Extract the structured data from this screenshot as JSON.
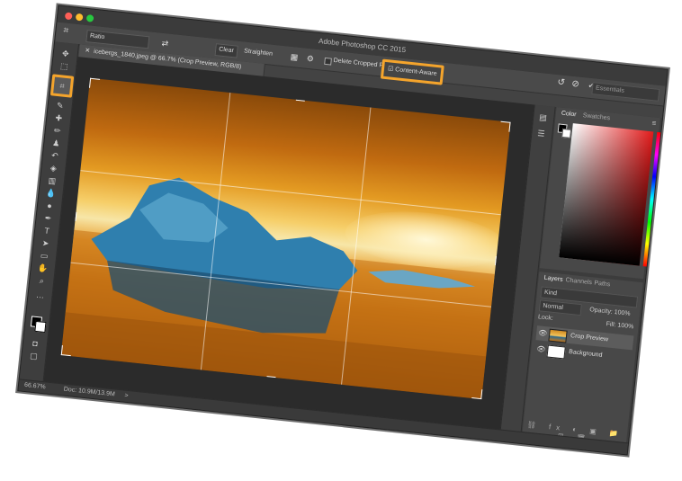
{
  "window": {
    "title": "Adobe Photoshop CC 2015"
  },
  "options_bar": {
    "tool_icon": "crop-options-icon",
    "ratio": "Ratio",
    "swap_icon": "⇄",
    "clear": "Clear",
    "straighten": "Straighten",
    "delete_cropped": "Delete Cropped Pixels",
    "content_aware": "Content-Aware",
    "search_placeholder": "Essentials"
  },
  "document": {
    "tab_label": "icebergs_1840.jpeg @ 66.7% (Crop Preview, RGB/8)",
    "zoom": "66.67%",
    "doc_info": "Doc: 10.9M/13.9M",
    "status_arrow": ">"
  },
  "toolbar": {
    "tools": [
      "move-icon",
      "marquee-icon",
      "lasso-icon",
      "quick-select-icon",
      "crop-icon",
      "eyedropper-icon",
      "healing-icon",
      "brush-icon",
      "stamp-icon",
      "history-brush-icon",
      "eraser-icon",
      "gradient-icon",
      "blur-icon",
      "dodge-icon",
      "pen-icon",
      "type-icon",
      "path-select-icon",
      "shape-icon",
      "hand-icon",
      "zoom-icon",
      "more-tools-icon"
    ]
  },
  "color_panel": {
    "tabs": [
      "Color",
      "Swatches"
    ],
    "active_tab": "Color",
    "foreground": "#000000",
    "background": "#ffffff",
    "hue": "#e21b1b"
  },
  "layers_panel": {
    "tabs": [
      "Layers",
      "Channels",
      "Paths"
    ],
    "active_tab": "Layers",
    "kind_filter": "Kind",
    "blend_mode": "Normal",
    "opacity": "Opacity: 100%",
    "lock": "Lock:",
    "fill": "Fill: 100%",
    "layers": [
      {
        "name": "Crop Preview",
        "selected": true
      },
      {
        "name": "Background",
        "selected": false
      }
    ]
  },
  "highlight_color": "#f4a42c"
}
